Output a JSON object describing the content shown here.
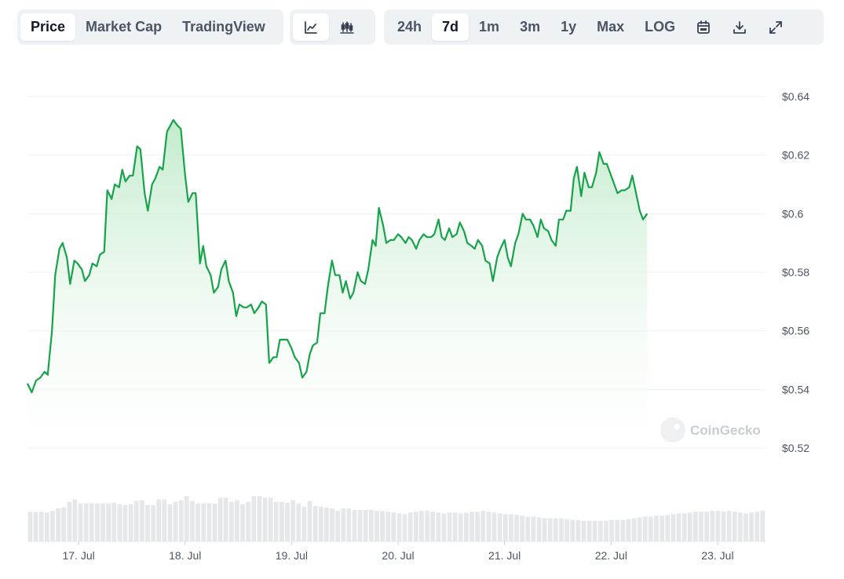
{
  "toolbar": {
    "metric_tabs": [
      "Price",
      "Market Cap",
      "TradingView"
    ],
    "active_metric": "Price",
    "chart_style_icons": [
      "line-chart-icon",
      "candlestick-chart-icon"
    ],
    "range_tabs": [
      "24h",
      "7d",
      "1m",
      "3m",
      "1y",
      "Max",
      "LOG"
    ],
    "active_range": "7d",
    "tool_icons": [
      "calendar-icon",
      "download-icon",
      "fullscreen-icon"
    ]
  },
  "watermark": "CoinGecko",
  "colors": {
    "line": "#16a34a",
    "fill_top": "#bfeac9",
    "volume": "#e5e7eb",
    "grid": "#eef0f3"
  },
  "chart_data": {
    "type": "area",
    "y_ticks": [
      "$0.64",
      "$0.62",
      "$0.6",
      "$0.58",
      "$0.56",
      "$0.54",
      "$0.52"
    ],
    "y_tick_values": [
      0.64,
      0.62,
      0.6,
      0.58,
      0.56,
      0.54,
      0.52
    ],
    "ylim": [
      0.52,
      0.64
    ],
    "x_ticks": [
      "17. Jul",
      "18. Jul",
      "19. Jul",
      "20. Jul",
      "21. Jul",
      "22. Jul",
      "23. Jul"
    ],
    "x_tick_positions": [
      1,
      2,
      3,
      4,
      5,
      6,
      7
    ],
    "xlim": [
      0.52,
      7.45
    ],
    "price": [
      [
        0.52,
        0.542
      ],
      [
        0.56,
        0.539
      ],
      [
        0.6,
        0.543
      ],
      [
        0.64,
        0.544
      ],
      [
        0.68,
        0.546
      ],
      [
        0.71,
        0.545
      ],
      [
        0.75,
        0.56
      ],
      [
        0.78,
        0.579
      ],
      [
        0.82,
        0.588
      ],
      [
        0.85,
        0.59
      ],
      [
        0.89,
        0.585
      ],
      [
        0.92,
        0.576
      ],
      [
        0.96,
        0.584
      ],
      [
        0.99,
        0.583
      ],
      [
        1.03,
        0.581
      ],
      [
        1.06,
        0.577
      ],
      [
        1.1,
        0.579
      ],
      [
        1.13,
        0.583
      ],
      [
        1.17,
        0.582
      ],
      [
        1.2,
        0.586
      ],
      [
        1.24,
        0.587
      ],
      [
        1.27,
        0.608
      ],
      [
        1.31,
        0.605
      ],
      [
        1.34,
        0.61
      ],
      [
        1.38,
        0.609
      ],
      [
        1.41,
        0.615
      ],
      [
        1.44,
        0.611
      ],
      [
        1.48,
        0.613
      ],
      [
        1.51,
        0.613
      ],
      [
        1.55,
        0.623
      ],
      [
        1.58,
        0.622
      ],
      [
        1.62,
        0.607
      ],
      [
        1.65,
        0.601
      ],
      [
        1.69,
        0.61
      ],
      [
        1.72,
        0.612
      ],
      [
        1.76,
        0.616
      ],
      [
        1.79,
        0.615
      ],
      [
        1.83,
        0.628
      ],
      [
        1.86,
        0.63
      ],
      [
        1.89,
        0.632
      ],
      [
        1.93,
        0.63
      ],
      [
        1.96,
        0.629
      ],
      [
        2.0,
        0.613
      ],
      [
        2.03,
        0.604
      ],
      [
        2.07,
        0.607
      ],
      [
        2.1,
        0.607
      ],
      [
        2.14,
        0.583
      ],
      [
        2.17,
        0.589
      ],
      [
        2.2,
        0.582
      ],
      [
        2.24,
        0.579
      ],
      [
        2.27,
        0.573
      ],
      [
        2.31,
        0.575
      ],
      [
        2.34,
        0.581
      ],
      [
        2.38,
        0.584
      ],
      [
        2.41,
        0.577
      ],
      [
        2.45,
        0.573
      ],
      [
        2.48,
        0.565
      ],
      [
        2.51,
        0.569
      ],
      [
        2.55,
        0.568
      ],
      [
        2.58,
        0.568
      ],
      [
        2.62,
        0.569
      ],
      [
        2.65,
        0.566
      ],
      [
        2.69,
        0.568
      ],
      [
        2.72,
        0.57
      ],
      [
        2.76,
        0.569
      ],
      [
        2.79,
        0.549
      ],
      [
        2.83,
        0.551
      ],
      [
        2.86,
        0.551
      ],
      [
        2.89,
        0.557
      ],
      [
        2.93,
        0.557
      ],
      [
        2.96,
        0.557
      ],
      [
        3.0,
        0.554
      ],
      [
        3.03,
        0.551
      ],
      [
        3.07,
        0.549
      ],
      [
        3.1,
        0.544
      ],
      [
        3.14,
        0.546
      ],
      [
        3.17,
        0.552
      ],
      [
        3.2,
        0.555
      ],
      [
        3.24,
        0.556
      ],
      [
        3.27,
        0.566
      ],
      [
        3.31,
        0.566
      ],
      [
        3.34,
        0.575
      ],
      [
        3.38,
        0.584
      ],
      [
        3.41,
        0.579
      ],
      [
        3.45,
        0.579
      ],
      [
        3.48,
        0.573
      ],
      [
        3.51,
        0.577
      ],
      [
        3.55,
        0.571
      ],
      [
        3.58,
        0.573
      ],
      [
        3.62,
        0.58
      ],
      [
        3.65,
        0.577
      ],
      [
        3.69,
        0.576
      ],
      [
        3.72,
        0.581
      ],
      [
        3.76,
        0.591
      ],
      [
        3.79,
        0.589
      ],
      [
        3.82,
        0.602
      ],
      [
        3.86,
        0.596
      ],
      [
        3.89,
        0.59
      ],
      [
        3.93,
        0.591
      ],
      [
        3.96,
        0.591
      ],
      [
        4.0,
        0.593
      ],
      [
        4.03,
        0.592
      ],
      [
        4.07,
        0.59
      ],
      [
        4.1,
        0.592
      ],
      [
        4.13,
        0.591
      ],
      [
        4.17,
        0.588
      ],
      [
        4.2,
        0.591
      ],
      [
        4.24,
        0.593
      ],
      [
        4.27,
        0.592
      ],
      [
        4.31,
        0.592
      ],
      [
        4.34,
        0.593
      ],
      [
        4.38,
        0.598
      ],
      [
        4.41,
        0.592
      ],
      [
        4.44,
        0.591
      ],
      [
        4.48,
        0.595
      ],
      [
        4.51,
        0.592
      ],
      [
        4.55,
        0.593
      ],
      [
        4.58,
        0.597
      ],
      [
        4.62,
        0.594
      ],
      [
        4.65,
        0.59
      ],
      [
        4.69,
        0.589
      ],
      [
        4.72,
        0.588
      ],
      [
        4.75,
        0.591
      ],
      [
        4.79,
        0.589
      ],
      [
        4.82,
        0.584
      ],
      [
        4.86,
        0.583
      ],
      [
        4.89,
        0.577
      ],
      [
        4.93,
        0.585
      ],
      [
        4.96,
        0.588
      ],
      [
        5.0,
        0.591
      ],
      [
        5.03,
        0.585
      ],
      [
        5.06,
        0.582
      ],
      [
        5.1,
        0.59
      ],
      [
        5.13,
        0.593
      ],
      [
        5.17,
        0.6
      ],
      [
        5.2,
        0.598
      ],
      [
        5.24,
        0.598
      ],
      [
        5.27,
        0.596
      ],
      [
        5.31,
        0.592
      ],
      [
        5.34,
        0.598
      ],
      [
        5.37,
        0.595
      ],
      [
        5.41,
        0.594
      ],
      [
        5.44,
        0.591
      ],
      [
        5.48,
        0.589
      ],
      [
        5.51,
        0.598
      ],
      [
        5.55,
        0.598
      ],
      [
        5.58,
        0.601
      ],
      [
        5.62,
        0.601
      ],
      [
        5.65,
        0.612
      ],
      [
        5.68,
        0.616
      ],
      [
        5.72,
        0.606
      ],
      [
        5.75,
        0.614
      ],
      [
        5.79,
        0.609
      ],
      [
        5.82,
        0.609
      ],
      [
        5.86,
        0.614
      ],
      [
        5.89,
        0.621
      ],
      [
        5.93,
        0.617
      ],
      [
        5.96,
        0.617
      ],
      [
        5.99,
        0.614
      ],
      [
        6.03,
        0.61
      ],
      [
        6.06,
        0.607
      ],
      [
        6.1,
        0.608
      ],
      [
        6.13,
        0.608
      ],
      [
        6.17,
        0.609
      ],
      [
        6.2,
        0.613
      ],
      [
        6.24,
        0.606
      ],
      [
        6.27,
        0.601
      ],
      [
        6.3,
        0.598
      ],
      [
        6.34,
        0.6
      ]
    ],
    "volume_relative": [
      0.36,
      0.36,
      0.36,
      0.35,
      0.37,
      0.4,
      0.41,
      0.48,
      0.51,
      0.46,
      0.46,
      0.46,
      0.46,
      0.46,
      0.46,
      0.47,
      0.45,
      0.44,
      0.45,
      0.49,
      0.5,
      0.44,
      0.44,
      0.51,
      0.51,
      0.45,
      0.48,
      0.5,
      0.55,
      0.49,
      0.46,
      0.46,
      0.46,
      0.46,
      0.53,
      0.53,
      0.48,
      0.5,
      0.45,
      0.48,
      0.55,
      0.55,
      0.53,
      0.53,
      0.48,
      0.48,
      0.47,
      0.5,
      0.46,
      0.42,
      0.49,
      0.43,
      0.42,
      0.41,
      0.4,
      0.37,
      0.4,
      0.4,
      0.38,
      0.38,
      0.38,
      0.38,
      0.37,
      0.37,
      0.36,
      0.35,
      0.34,
      0.33,
      0.35,
      0.36,
      0.37,
      0.37,
      0.36,
      0.35,
      0.34,
      0.35,
      0.35,
      0.34,
      0.35,
      0.36,
      0.36,
      0.37,
      0.36,
      0.35,
      0.34,
      0.33,
      0.33,
      0.32,
      0.31,
      0.3,
      0.3,
      0.29,
      0.28,
      0.28,
      0.28,
      0.28,
      0.27,
      0.26,
      0.26,
      0.25,
      0.25,
      0.25,
      0.25,
      0.25,
      0.26,
      0.26,
      0.26,
      0.27,
      0.28,
      0.29,
      0.3,
      0.3,
      0.31,
      0.31,
      0.32,
      0.33,
      0.34,
      0.34,
      0.35,
      0.36,
      0.36,
      0.36,
      0.37,
      0.37,
      0.36,
      0.37,
      0.36,
      0.35,
      0.34,
      0.35,
      0.36,
      0.37
    ]
  }
}
